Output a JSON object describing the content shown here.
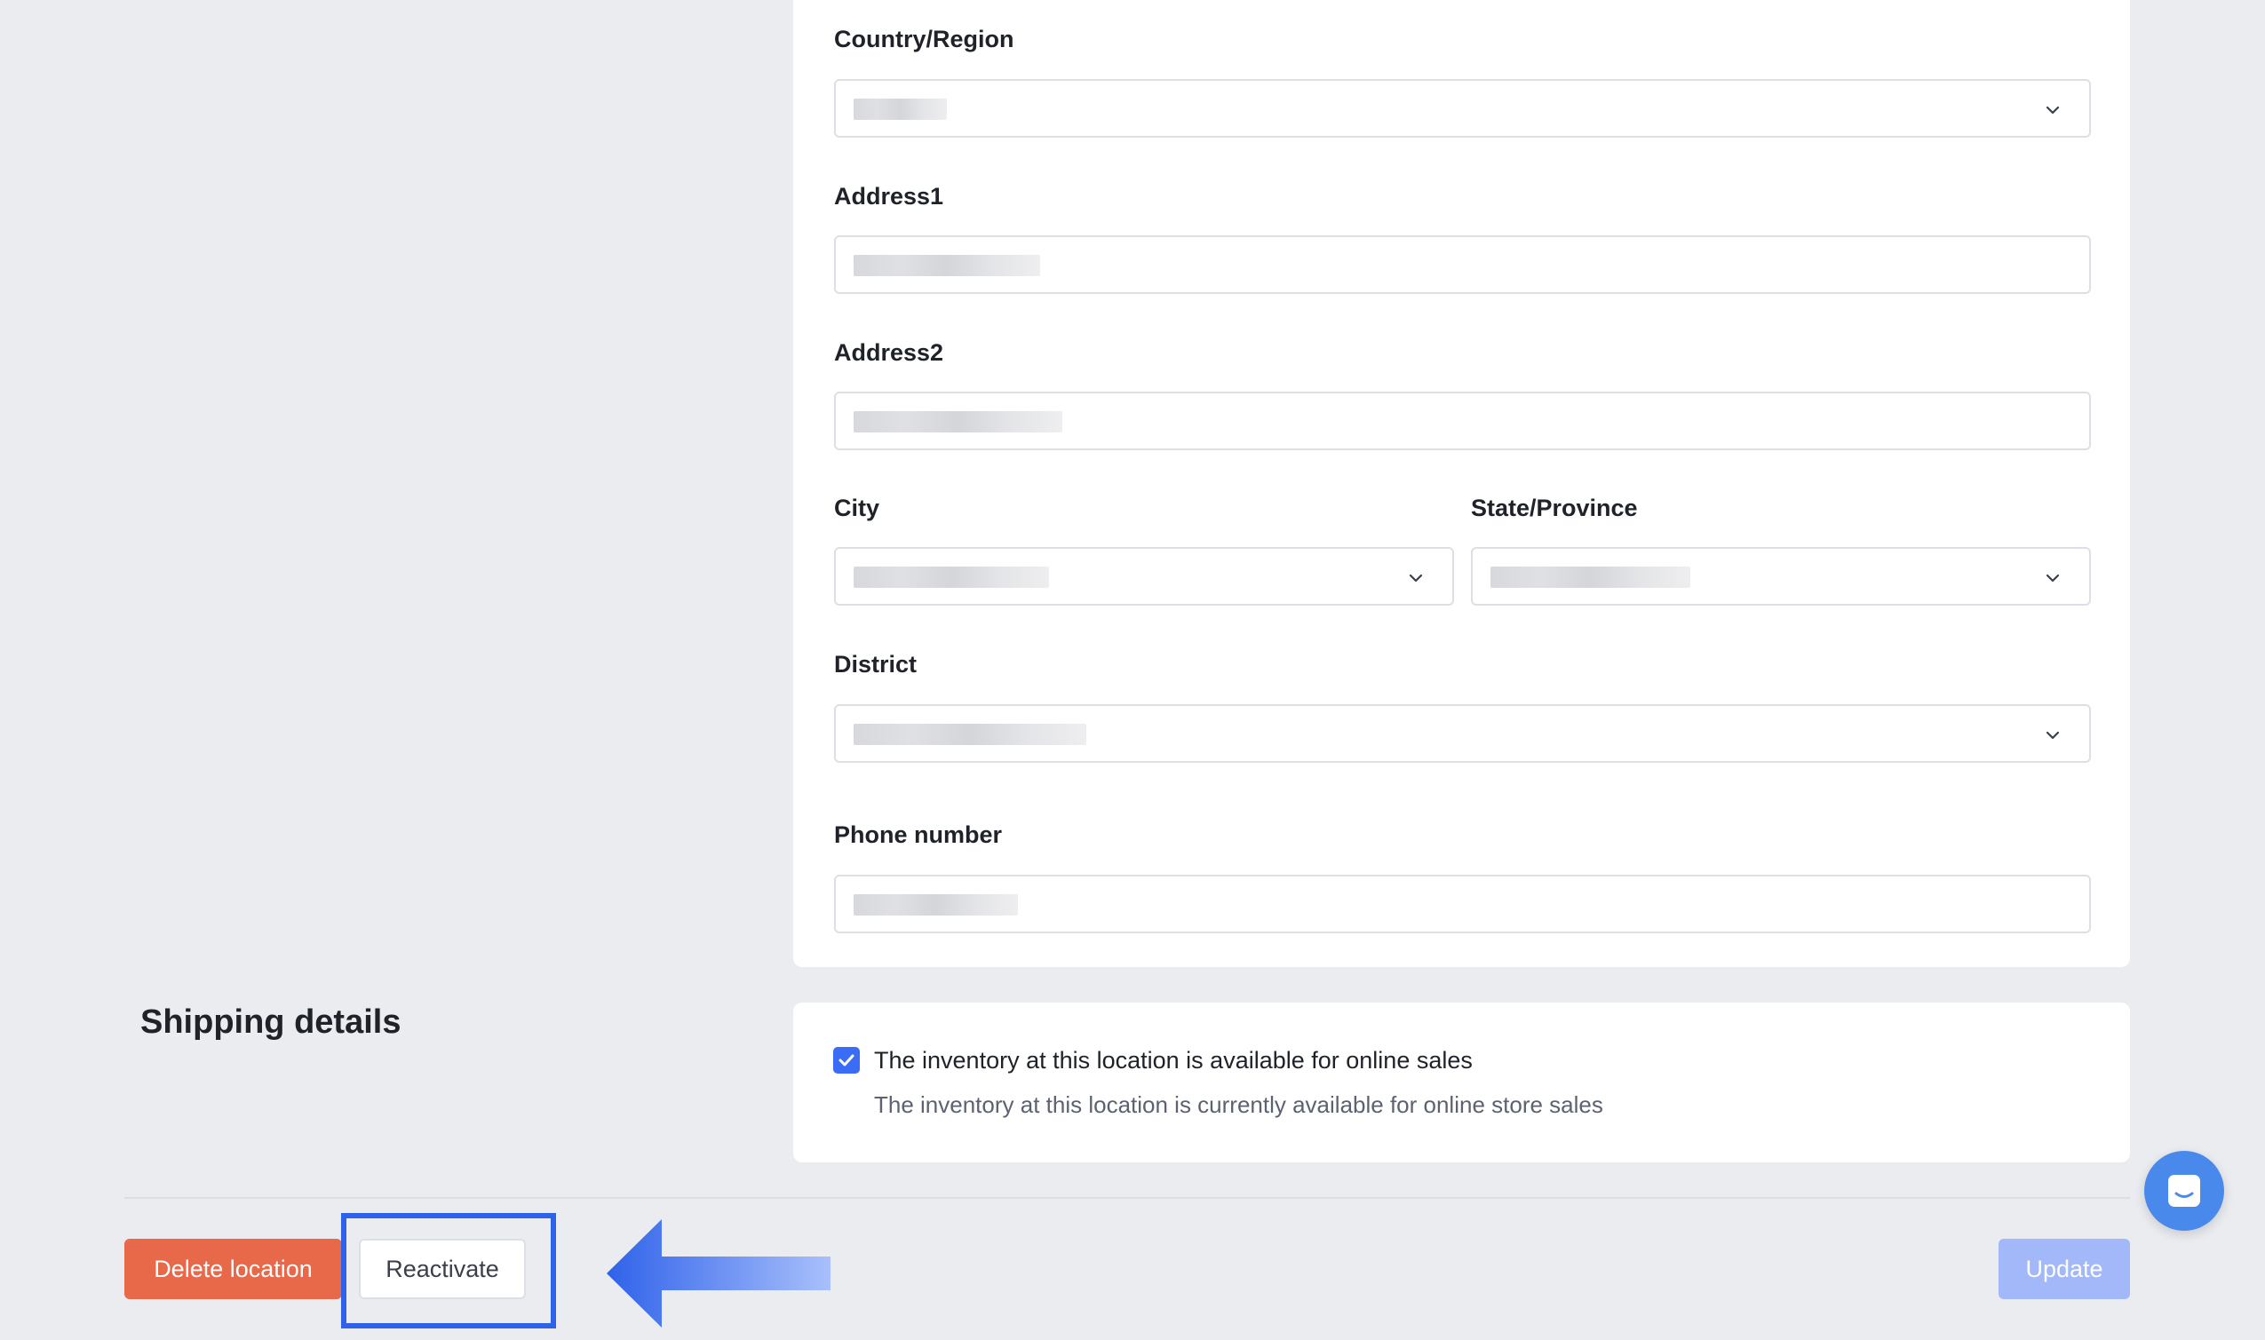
{
  "form": {
    "country_label": "Country/Region",
    "address1_label": "Address1",
    "address2_label": "Address2",
    "city_label": "City",
    "state_label": "State/Province",
    "district_label": "District",
    "phone_label": "Phone number"
  },
  "shipping": {
    "section_title": "Shipping details",
    "online_sales_checked": true,
    "online_sales_label": "The inventory at this location is available for online sales",
    "online_sales_desc": "The inventory at this location is currently available for online store sales"
  },
  "actions": {
    "delete_label": "Delete location",
    "reactivate_label": "Reactivate",
    "update_label": "Update"
  },
  "icons": {
    "select_chevron": "chevron-down-icon",
    "checkbox": "checkmark-icon",
    "chat": "chat-icon",
    "annotation_arrow": "arrow-left-icon"
  },
  "colors": {
    "primary": "#3b6cf6",
    "danger": "#e8684a",
    "update_disabled": "#a2b8f8",
    "annotation": "#2f62ea",
    "chat": "#4a89ec"
  }
}
